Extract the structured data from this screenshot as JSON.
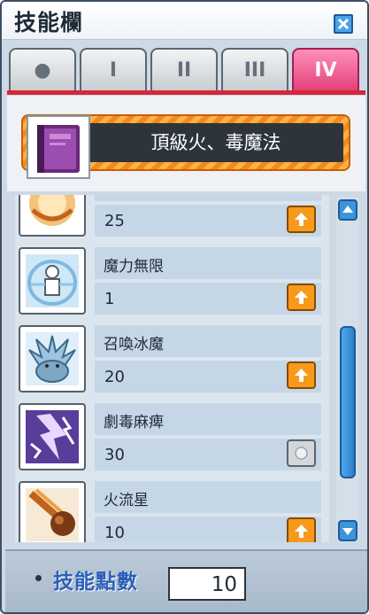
{
  "window": {
    "title": "技能欄",
    "close_icon": "close-icon"
  },
  "tabs": [
    {
      "label": "●",
      "name": "beginner",
      "active": false
    },
    {
      "label": "I",
      "name": "first-job",
      "active": false
    },
    {
      "label": "II",
      "name": "second-job",
      "active": false
    },
    {
      "label": "III",
      "name": "third-job",
      "active": false
    },
    {
      "label": "IV",
      "name": "fourth-job",
      "active": true
    }
  ],
  "category": {
    "title": "頂級火、毒魔法",
    "icon": "spellbook-icon"
  },
  "skills": [
    {
      "name": "",
      "level": "25",
      "icon": "fire-swirl-icon",
      "upgradable": true
    },
    {
      "name": "魔力無限",
      "level": "1",
      "icon": "infinity-icon",
      "upgradable": true
    },
    {
      "name": "召喚冰魔",
      "level": "20",
      "icon": "ice-demon-icon",
      "upgradable": true
    },
    {
      "name": "劇毒麻痺",
      "level": "30",
      "icon": "paralyze-icon",
      "upgradable": false
    },
    {
      "name": "火流星",
      "level": "10",
      "icon": "meteor-icon",
      "upgradable": true
    }
  ],
  "footer": {
    "points_label": "技能點數",
    "points_value": "10"
  },
  "colors": {
    "accent_tab": "#e2417a",
    "tab_underline": "#d6263a",
    "upgrade_button": "#f79a1c",
    "points_label": "#2b5fb8",
    "scrollbar": "#3f93d8"
  }
}
